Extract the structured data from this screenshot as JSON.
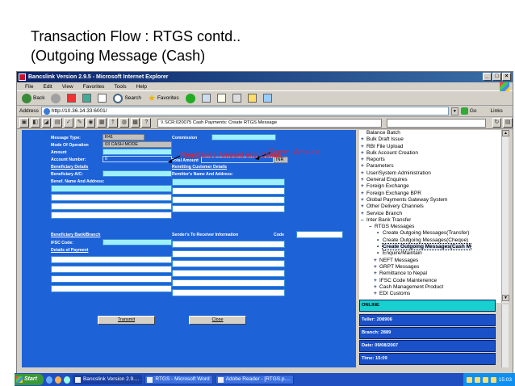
{
  "slide": {
    "title_line1": "Transaction Flow : RTGS contd..",
    "title_line2": "(Outgoing Message (Cash)"
  },
  "window": {
    "title": "Bancslink Version 2.9.5 - Microsoft Internet Explorer"
  },
  "menu": [
    "File",
    "Edit",
    "View",
    "Favorites",
    "Tools",
    "Help"
  ],
  "toolbar": {
    "back": "Back",
    "search": "Search",
    "favorites": "Favorites"
  },
  "address": {
    "label": "Address",
    "value": "http://10.36.14.33:6001/",
    "go": "Go",
    "links": "Links"
  },
  "screen_label": "\\\\ SCR:020075 Cash Payments: Create RTGS Message",
  "form": {
    "message_type_label": "Message Type:",
    "message_type_value": "R41",
    "mode_label": "Mode Of Operation",
    "mode_value": "03 CASH MODE",
    "amount_label": "Amount",
    "account_label": "Account Number:",
    "account_value": "0",
    "commission_label": "Commission",
    "total_amount_label": "Total Amount",
    "total_currency": "INR",
    "beneficiary_details": "Beneficiary Details",
    "beneficiary_ac": "Beneficiary A/C:",
    "benef_name_address": "Benef. Name And Address:",
    "remitting_customer_details": "Remitting Customer Details",
    "remitter_name_address": "Remitter's Name And Address:",
    "beneficiary_bank": "Beneficiary Bank/Branch",
    "ifsc_code": "IFSC Code:",
    "details_of_payment": "Details of Payment",
    "sender_to_receiver": "Sender's To Receiver Information",
    "code_label": "Code",
    "transmit": "Transmit",
    "close": "Close"
  },
  "annotations": {
    "commission": "Comm. Amount",
    "total": "Remittance Amount excl Comm."
  },
  "tree": [
    {
      "glyph": "",
      "label": "Balance Batch"
    },
    {
      "glyph": "+",
      "label": "Bulk Draft Issue"
    },
    {
      "glyph": "+",
      "label": "RBI File Upload"
    },
    {
      "glyph": "+",
      "label": "Bulk Account Creation"
    },
    {
      "glyph": "+",
      "label": "Reports"
    },
    {
      "glyph": "+",
      "label": "Parameters"
    },
    {
      "glyph": "+",
      "label": "User/System Administration"
    },
    {
      "glyph": "+",
      "label": "General Enquires"
    },
    {
      "glyph": "+",
      "label": "Foreign Exchange"
    },
    {
      "glyph": "+",
      "label": "Foreign Exchange BPR"
    },
    {
      "glyph": "+",
      "label": "Global Payments Gateway System"
    },
    {
      "glyph": "+",
      "label": "Other Delivery Channels"
    },
    {
      "glyph": "+",
      "label": "Service Branch"
    },
    {
      "glyph": "–",
      "label": "Inter Bank Transfer"
    },
    {
      "glyph": "–",
      "label": "RTGS Messages"
    },
    {
      "glyph": "•",
      "label": "Create Outgoing Messages(Transfer)"
    },
    {
      "glyph": "•",
      "label": "Create Outgoing Messages(Cheque)"
    },
    {
      "glyph": "•",
      "label": "Create Outgoing Messages(Cash M"
    },
    {
      "glyph": "•",
      "label": "Enquire/Maintain"
    },
    {
      "glyph": "+",
      "label": "NEFT Messages"
    },
    {
      "glyph": "+",
      "label": "GRPT Messages"
    },
    {
      "glyph": "+",
      "label": "Remittance to Nepal"
    },
    {
      "glyph": "+",
      "label": "IFSC Code Maintenence"
    },
    {
      "glyph": "+",
      "label": "Cash Management Product"
    },
    {
      "glyph": "+",
      "label": "EDI Customs"
    }
  ],
  "status": {
    "online": "ONLINE",
    "teller": "Teller: 208906",
    "branch": "Branch: 2889",
    "date": "Date: 09/08/2007",
    "time": "Time: 15:09"
  },
  "taskbar": {
    "start": "Start",
    "task1": "Bancslink Version 2.9....",
    "task2": "RTGS - Microsoft Word",
    "task3": "Adobe Reader - [RTGS.p....",
    "clock": "15:03"
  }
}
